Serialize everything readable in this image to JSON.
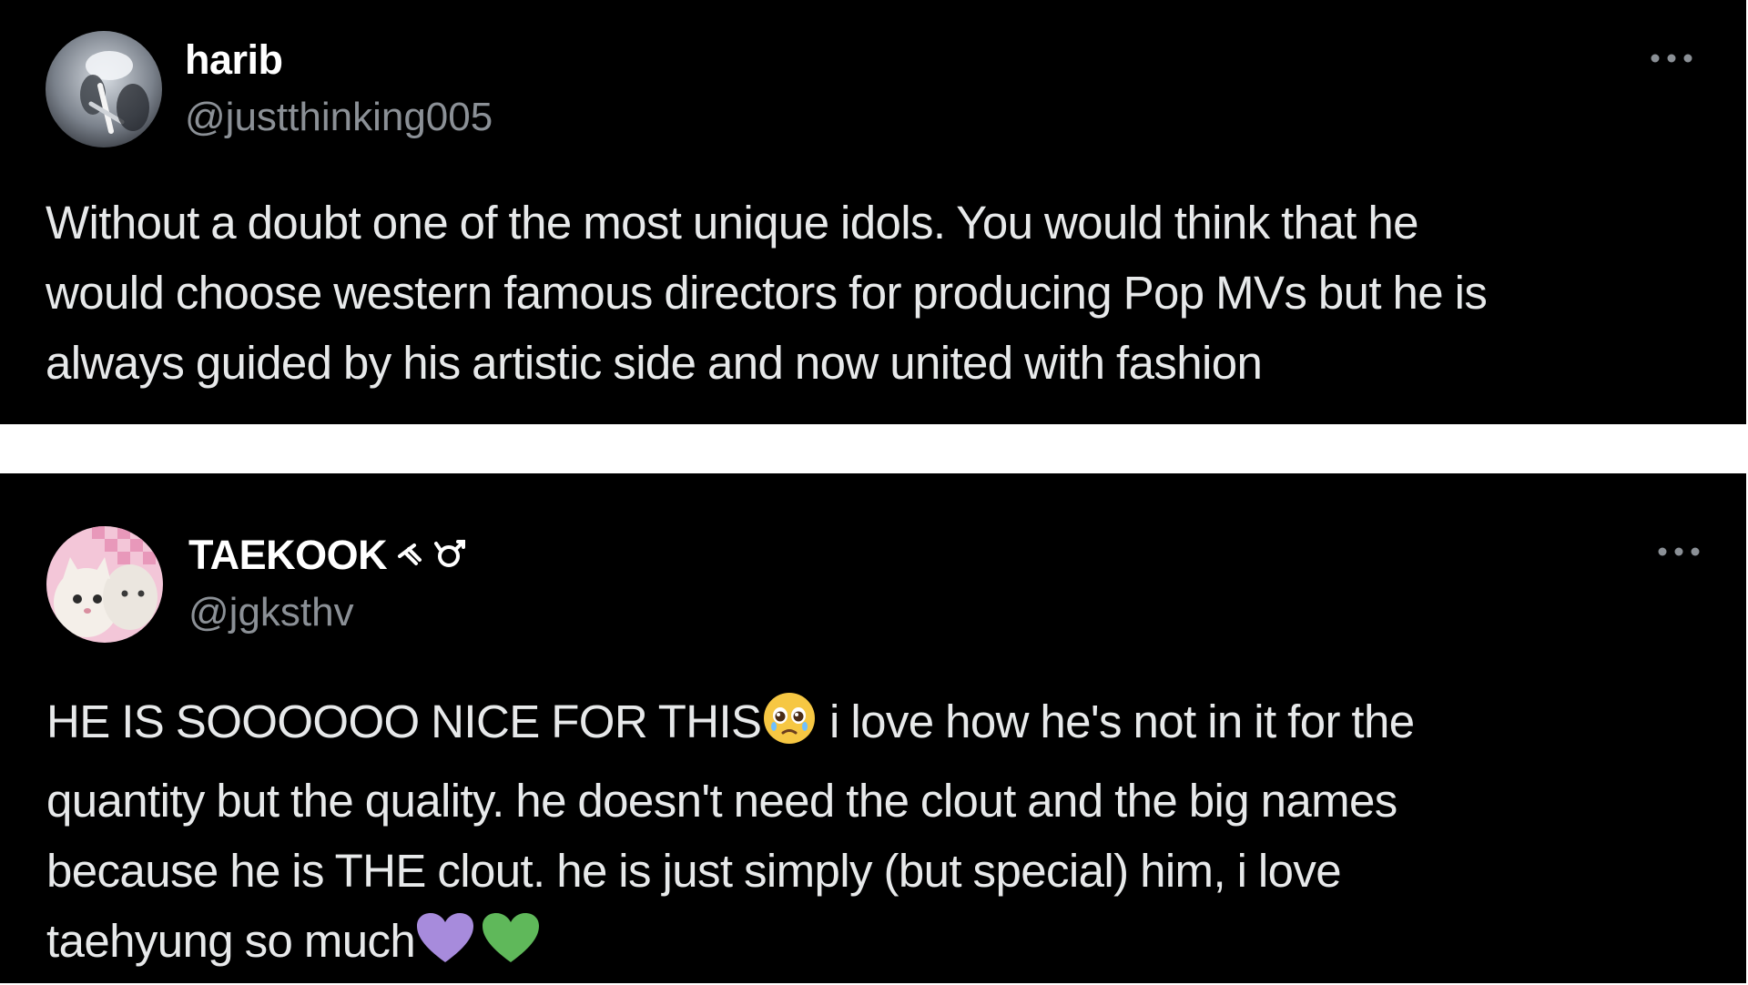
{
  "tweets": [
    {
      "display_name": "harib",
      "handle": "@justthinking005",
      "more_icon": "more-dots-icon",
      "avatar_icon": "avatar-photo",
      "lines": [
        "Without a doubt one of the most unique idols. You would think that he",
        "would choose western famous directors for producing Pop MVs but he is",
        "always guided by his artistic side and now united with fashion"
      ]
    },
    {
      "display_name": "TAEKOOK",
      "name_symbols_icon": "name-symbols-icon",
      "handle": "@jgksthv",
      "more_icon": "more-dots-icon",
      "avatar_icon": "avatar-cats",
      "lines": [
        {
          "before": "HE IS SOOOOOO NICE FOR THIS",
          "emoji": "pleading-face-emoji",
          "after": " i love how he's not in it for the"
        },
        {
          "text": "quantity but the quality. he doesn't need the clout and the big names"
        },
        {
          "text": "because he is THE clout. he is just simply (but special) him, i love"
        },
        {
          "before": "taehyung so much",
          "emoji1": "purple-heart-emoji",
          "emoji2": "green-heart-emoji"
        }
      ]
    }
  ],
  "colors": {
    "background": "#000000",
    "separator": "#ffffff",
    "text_primary": "#e7e9ea",
    "text_secondary": "#8b9096",
    "purple_heart": "#a78bdc",
    "green_heart": "#5fb85a",
    "emoji_yellow": "#f6c743"
  }
}
